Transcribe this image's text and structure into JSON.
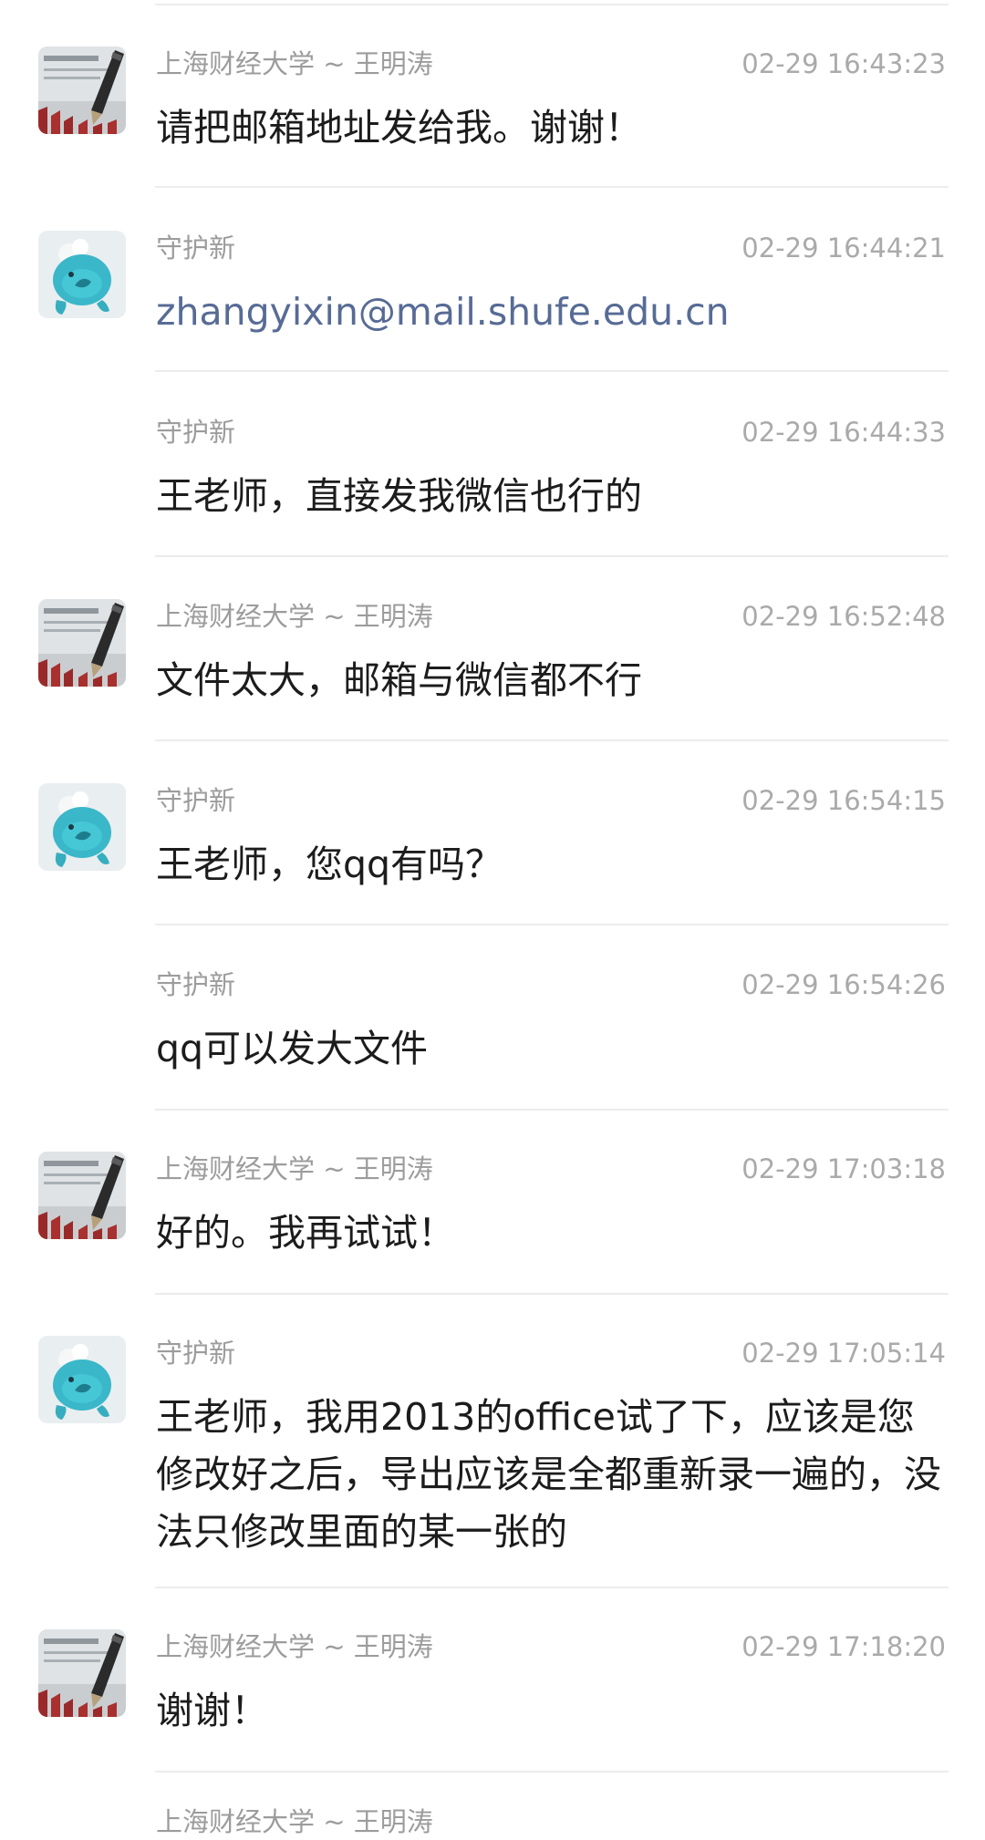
{
  "messages": [
    {
      "sender": "上海财经大学 ~ 王明涛",
      "time": "02-29 16:43:23",
      "text": "请把邮箱地址发给我。谢谢！",
      "avatar": "pen-on-paper-avatar"
    },
    {
      "sender": "守护新",
      "time": "02-29 16:44:21",
      "text": "zhangyixin@mail.shufe.edu.cn",
      "avatar": "blue-toy-avatar",
      "is_link": true
    },
    {
      "sender": "守护新",
      "time": "02-29 16:44:33",
      "text": "王老师，直接发我微信也行的",
      "avatar": null
    },
    {
      "sender": "上海财经大学 ~ 王明涛",
      "time": "02-29 16:52:48",
      "text": "文件太大，邮箱与微信都不行",
      "avatar": "pen-on-paper-avatar"
    },
    {
      "sender": "守护新",
      "time": "02-29 16:54:15",
      "text": "王老师，您qq有吗？",
      "avatar": "blue-toy-avatar"
    },
    {
      "sender": "守护新",
      "time": "02-29 16:54:26",
      "text": "qq可以发大文件",
      "avatar": null
    },
    {
      "sender": "上海财经大学 ~ 王明涛",
      "time": "02-29 17:03:18",
      "text": "好的。我再试试！",
      "avatar": "pen-on-paper-avatar"
    },
    {
      "sender": "守护新",
      "time": "02-29 17:05:14",
      "text": "王老师，我用2013的office试了下，应该是您修改好之后，导出应该是全都重新录一遍的，没法只修改里面的某一张的",
      "avatar": "blue-toy-avatar"
    },
    {
      "sender": "上海财经大学 ~ 王明涛",
      "time": "02-29 17:18:20",
      "text": "谢谢！",
      "avatar": "pen-on-paper-avatar"
    }
  ],
  "cutoff_sender": "上海财经大学 ~ 王明涛"
}
